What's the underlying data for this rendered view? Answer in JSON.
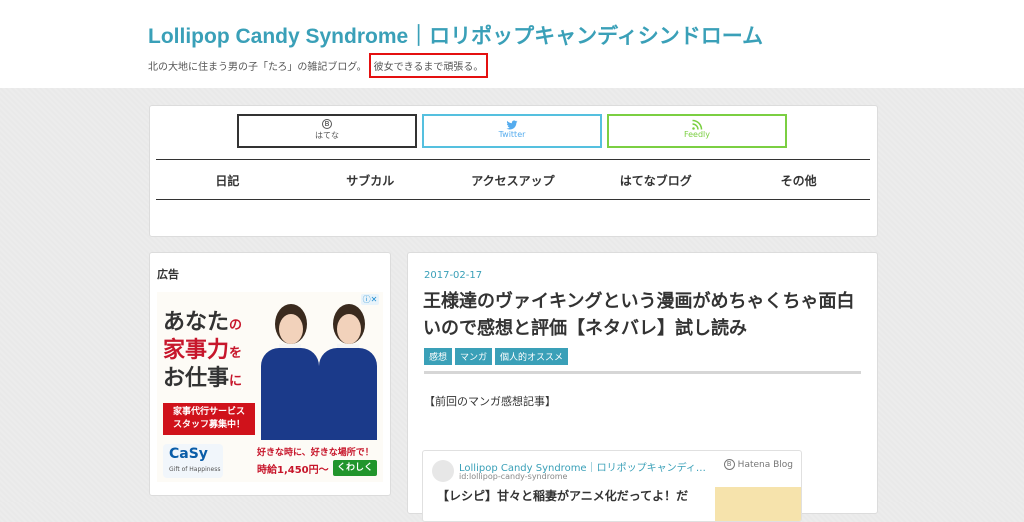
{
  "header": {
    "site_title": "Lollipop Candy Syndrome｜ロリポップキャンディシンドローム",
    "tagline_prefix": "北の大地に住まう男の子「たろ」の雑記ブログ。",
    "tagline_highlight": "彼女できるまで頑張る。"
  },
  "share": {
    "hatena": "はてな",
    "twitter": "Twitter",
    "feedly": "Feedly"
  },
  "menu": [
    "日記",
    "サブカル",
    "アクセスアップ",
    "はてなブログ",
    "その他"
  ],
  "sidebar": {
    "ad_heading": "広告",
    "ad": {
      "line1": "あなた",
      "line1_small": "の",
      "line2": "家事力",
      "line2_small": "を",
      "line3": "お仕事",
      "line3_small": "に",
      "recruit": "家事代行サービス\nスタッフ募集中！",
      "brand": "CaSy",
      "brand_sub": "Gift of Happiness",
      "tagline": "好きな時に、好きな場所で！",
      "price": "時給1,450円～",
      "more": "くわしく"
    }
  },
  "article": {
    "date": "2017-02-17",
    "title": "王様達のヴァイキングという漫画がめちゃくちゃ面白いので感想と評価【ネタバレ】試し読み",
    "categories": [
      "感想",
      "マンガ",
      "個人的オススメ"
    ],
    "body_first_line": "【前回のマンガ感想記事】",
    "embed": {
      "blog_name": "Lollipop Candy Syndrome｜ロリポップキャンディシンド…",
      "blog_id": "id:lollipop-candy-syndrome",
      "service": "Hatena Blog",
      "title": "【レシピ】甘々と稲妻がアニメ化だってよ！だ"
    }
  }
}
